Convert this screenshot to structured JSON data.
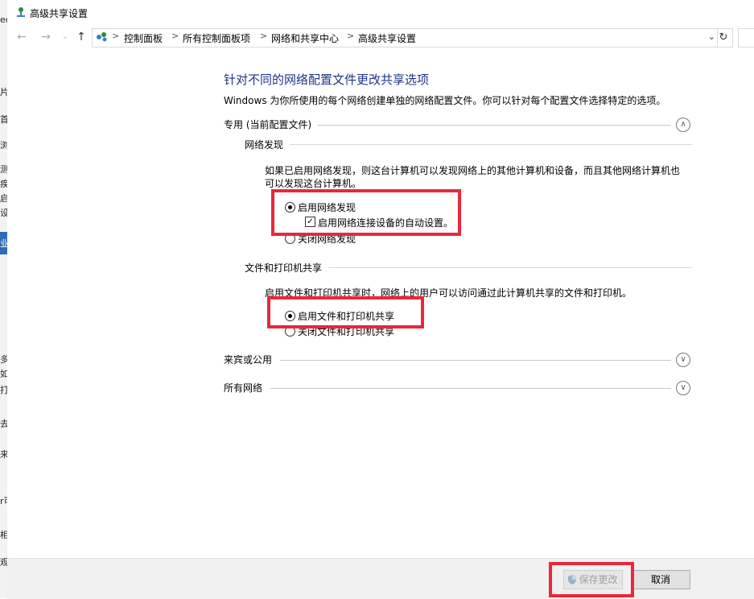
{
  "window": {
    "title": "高级共享设置"
  },
  "background_window": {
    "fragments": [
      "eo",
      "片",
      "首",
      "浏",
      "测",
      "疾",
      "启",
      "设",
      "业",
      "多",
      "如",
      "打",
      "去",
      "来",
      "r可",
      "相",
      "观"
    ]
  },
  "nav": {
    "back_icon": "back-arrow-icon",
    "forward_icon": "forward-arrow-icon",
    "up_icon": "up-arrow-icon",
    "breadcrumbs": [
      "控制面板",
      "所有控制面板项",
      "网络和共享中心",
      "高级共享设置"
    ],
    "separator": ">",
    "refresh_icon": "refresh-icon"
  },
  "main": {
    "heading": "针对不同的网络配置文件更改共享选项",
    "description": "Windows 为你所使用的每个网络创建单独的网络配置文件。你可以针对每个配置文件选择特定的选项。",
    "private_profile": {
      "label": "专用 (当前配置文件)",
      "network_discovery": {
        "title": "网络发现",
        "text": "如果已启用网络发现，则这台计算机可以发现网络上的其他计算机和设备，而且其他网络计算机也可以发现这台计算机。",
        "option_on": "启用网络发现",
        "auto_setup": "启用网络连接设备的自动设置。",
        "option_off": "关闭网络发现"
      },
      "file_sharing": {
        "title": "文件和打印机共享",
        "text": "启用文件和打印机共享时，网络上的用户可以访问通过此计算机共享的文件和打印机。",
        "option_on": "启用文件和打印机共享",
        "option_off": "关闭文件和打印机共享"
      }
    },
    "guest_profile": {
      "label": "来宾或公用"
    },
    "all_networks": {
      "label": "所有网络"
    }
  },
  "footer": {
    "save_label": "保存更改",
    "cancel_label": "取消"
  },
  "colors": {
    "heading": "#1e3287",
    "highlight_box": "#e8283c",
    "selected_strip": "#2d6db5"
  }
}
